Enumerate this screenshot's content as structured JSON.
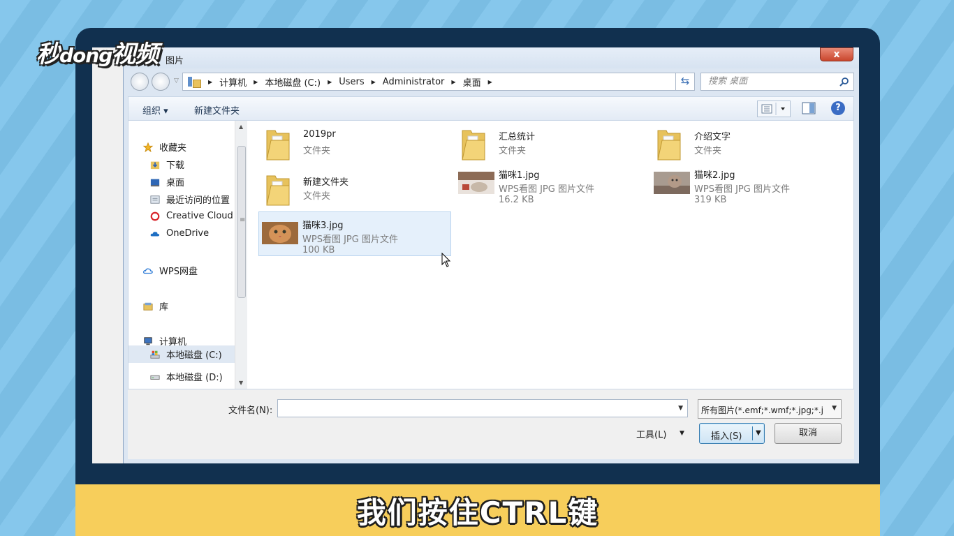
{
  "watermark": {
    "logo_text": "秒dong视频"
  },
  "subtitle": "我们按住CTRL键",
  "dialog": {
    "title": "图片",
    "close_label": "x"
  },
  "address": {
    "crumbs": [
      "计算机",
      "本地磁盘 (C:)",
      "Users",
      "Administrator",
      "桌面"
    ]
  },
  "search": {
    "placeholder": "搜索 桌面"
  },
  "toolbar": {
    "organize": "组织 ▾",
    "new_folder": "新建文件夹"
  },
  "nav": {
    "favorites": "收藏夹",
    "downloads": "下载",
    "desktop": "桌面",
    "recent": "最近访问的位置",
    "creative_cloud": "Creative Cloud",
    "onedrive": "OneDrive",
    "wps_drive": "WPS网盘",
    "library": "库",
    "computer": "计算机",
    "disk_c": "本地磁盘 (C:)",
    "disk_d": "本地磁盘 (D:)"
  },
  "files": [
    {
      "name": "2019pr",
      "type": "文件夹",
      "size": "",
      "kind": "folder"
    },
    {
      "name": "汇总统计",
      "type": "文件夹",
      "size": "",
      "kind": "folder"
    },
    {
      "name": "介绍文字",
      "type": "文件夹",
      "size": "",
      "kind": "folder"
    },
    {
      "name": "新建文件夹",
      "type": "文件夹",
      "size": "",
      "kind": "folder"
    },
    {
      "name": "猫咪1.jpg",
      "type": "WPS看图 JPG 图片文件",
      "size": "16.2 KB",
      "kind": "image"
    },
    {
      "name": "猫咪2.jpg",
      "type": "WPS看图 JPG 图片文件",
      "size": "319 KB",
      "kind": "image"
    },
    {
      "name": "猫咪3.jpg",
      "type": "WPS看图 JPG 图片文件",
      "size": "100 KB",
      "kind": "image",
      "selected": true
    }
  ],
  "footer": {
    "filename_label": "文件名(N):",
    "filename_value": "",
    "filetype_value": "所有图片(*.emf;*.wmf;*.jpg;*.j",
    "tools_label": "工具(L)",
    "insert_label": "插入(S)",
    "cancel_label": "取消"
  },
  "colors": {
    "background": "#7ec0e6",
    "monitor_frame": "#11304f",
    "subtitle_bar": "#f7ce5b",
    "selection": "#e5f0fb",
    "close_button": "#c9462d"
  }
}
